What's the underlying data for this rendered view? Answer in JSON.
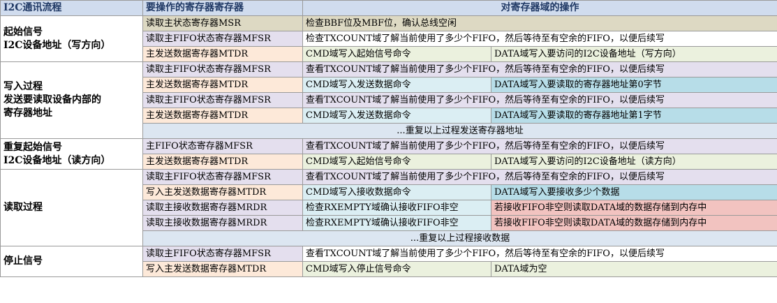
{
  "header": {
    "col1": "I2C通讯流程",
    "col2": "要操作的寄存器寄存器",
    "col3": "对寄存器域的操作"
  },
  "stages": {
    "start": [
      "起始信号",
      "I2C设备地址（写方向）"
    ],
    "write": [
      "写入过程",
      "发送要读取设备内部的",
      "寄存器地址"
    ],
    "restart": [
      "重复起始信号",
      "I2C设备地址（读方向）"
    ],
    "read": [
      "读取过程"
    ],
    "stop": [
      "停止信号"
    ]
  },
  "rows": {
    "r1": {
      "reg": "读取主状态寄存器MSR",
      "op": "检查BBF位及MBF位，确认总线空闲"
    },
    "r2": {
      "reg": "读取主FIFO状态寄存器MFSR",
      "op": "检查TXCOUNT域了解当前使用了多少个FIFO，然后等待至有空余的FIFO，以便后续写"
    },
    "r3": {
      "reg": "主发送数据寄存器MTDR",
      "cmd": "CMD域写入起始信号命令",
      "data": "DATA域写入要访问的I2C设备地址（写方向）"
    },
    "r4": {
      "reg": "读取主FIFO状态寄存器MFSR",
      "op": " 查看TXCOUNT域了解当前使用了多少个FIFO，然后等待至有空余的FIFO，以便后续写"
    },
    "r5": {
      "reg": "主发送数据寄存器MTDR",
      "cmd": "CMD域写入发送数据命令",
      "data": "DATA域写入要读取的寄存器地址第0字节"
    },
    "r6": {
      "reg": "读取主FIFO状态寄存器MFSR",
      "op": "查看TXCOUNT域了解当前使用了多少个FIFO，然后等待至有空余的FIFO，以便后续写"
    },
    "r7": {
      "reg": "主发送数据寄存器MTDR",
      "cmd": "CMD域写入发送数据命令",
      "data": "DATA域写入要读取的寄存器地址第1字节"
    },
    "r8": {
      "note": "...重复以上过程发送寄存器地址"
    },
    "r9": {
      "reg": "主FIFO状态寄存器MFSR",
      "op": "查看TXCOUNT域了解当前使用了多少个FIFO，然后等待至有空余的FIFO，以便后续写"
    },
    "r10": {
      "reg": "主发送数据寄存器MTDR",
      "cmd": "CMD域写入起始信号命令",
      "data": "DATA域写入要访问的I2C设备地址（读方向）"
    },
    "r11": {
      "reg": "读取主FIFO状态寄存器MFSR",
      "op": "查看TXCOUNT域了解当前使用了多少个FIFO，然后等待至有空余的FIFO，以便后续写"
    },
    "r12": {
      "reg": "写入主发送数据寄存器MTDR",
      "cmd": "CMD域写入接收数据命令",
      "data": "DATA域写入要接收多少个数据"
    },
    "r13": {
      "reg": "读取主接收数据寄存器MRDR",
      "cmd": "检查RXEMPTY域确认接收FIFO非空",
      "data": "若接收FIFO非空则读取DATA域的数据存储到内存中"
    },
    "r14": {
      "reg": "读取主接收数据寄存器MRDR",
      "cmd": "检查RXEMPTY域确认接收FIFO非空",
      "data": "若接收FIFO非空则读取DATA域的数据存储到内存中"
    },
    "r15": {
      "note": "...重复以上过程接收数据"
    },
    "r16": {
      "reg": "读取主FIFO状态寄存器MFSR",
      "op": "查看TXCOUNT域了解当前使用了多少个FIFO，然后等待至有空余的FIFO，以便后续写"
    },
    "r17": {
      "reg": "写入主发送数据寄存器MTDR",
      "cmd": "CMD域写入停止信号命令",
      "data": "DATA域为空"
    }
  },
  "colors": {
    "header": "#d0dcee",
    "register_status": "#e4dfee",
    "register_tx": "#fde9d9",
    "msr_row": "#ddd9c3",
    "cmd": "#ebf1de",
    "fifo_op": "#dbeef3",
    "data_addr": "#b7dde8",
    "data_rx": "#f2c3c0",
    "repeat_note": "#dce6f1"
  }
}
